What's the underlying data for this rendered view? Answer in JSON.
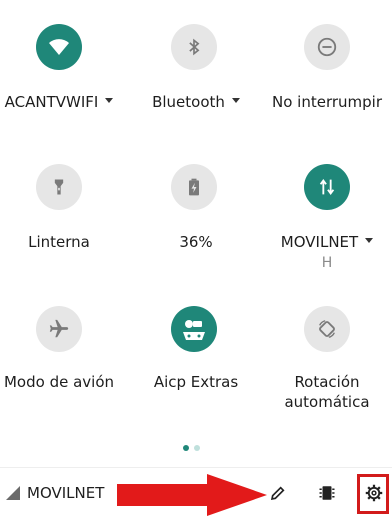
{
  "tiles": [
    {
      "label": "ACANTVWIFI",
      "icon": "wifi-icon",
      "state": "on",
      "caret": true
    },
    {
      "label": "Bluetooth",
      "icon": "bluetooth-icon",
      "state": "off",
      "caret": true
    },
    {
      "label": "No interrumpir",
      "icon": "do-not-disturb-icon",
      "state": "off",
      "caret": false
    },
    {
      "label": "Linterna",
      "icon": "flashlight-icon",
      "state": "off",
      "caret": false
    },
    {
      "label": "36%",
      "icon": "battery-charging-icon",
      "state": "off",
      "caret": false
    },
    {
      "label": "MOVILNET",
      "sublabel": "H",
      "icon": "mobile-data-icon",
      "state": "on",
      "caret": true
    },
    {
      "label": "Modo de avión",
      "icon": "airplane-icon",
      "state": "off",
      "caret": false
    },
    {
      "label": "Aicp Extras",
      "icon": "aicp-extras-icon",
      "state": "on",
      "caret": false
    },
    {
      "label": "Rotación automática",
      "icon": "auto-rotate-icon",
      "state": "off",
      "caret": false
    }
  ],
  "pager": {
    "active_index": 0,
    "count": 2
  },
  "bottom_bar": {
    "carrier": "MOVILNET",
    "icons": [
      "edit-pencil-icon",
      "sim-card-icon",
      "settings-gear-icon"
    ]
  },
  "colors": {
    "accent": "#1f8779",
    "inactive_circle": "#e6e6e6",
    "annotation_red": "#d21b1b"
  }
}
